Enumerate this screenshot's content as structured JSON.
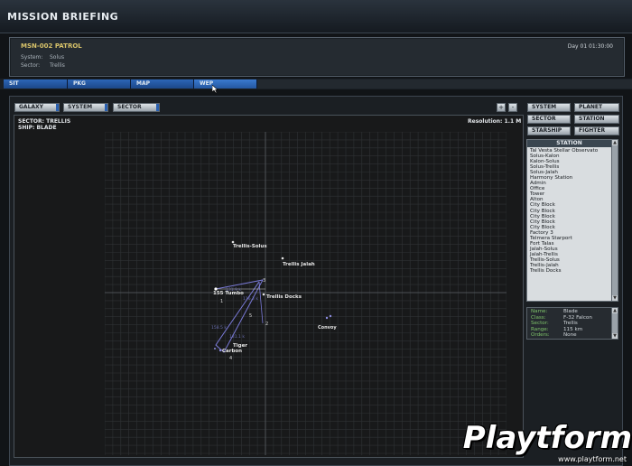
{
  "window": {
    "title": "MISSION BRIEFING"
  },
  "mission": {
    "name": "MSN-002 PATROL",
    "system_label": "System:",
    "system_value": "Solus",
    "sector_label": "Sector:",
    "sector_value": "Trellis",
    "day_time": "Day 01 01:30:00"
  },
  "tabs": [
    "SIT",
    "PKG",
    "MAP",
    "WEP"
  ],
  "scope": {
    "galaxy": "GALAXY",
    "system": "SYSTEM",
    "sector": "SECTOR"
  },
  "zoom": {
    "plus": "+",
    "minus": "-"
  },
  "map": {
    "sector_line": "SECTOR: TRELLIS",
    "ship_line": "SHIP: BLADE",
    "resolution": "Resolution: 1.1 M",
    "labels": {
      "trellis_solus": "Trellis-Solus",
      "trellis_jalah": "Trellis Jalah",
      "trellis_docks": "Trellis Docks",
      "tumbo": "155 Tumbo",
      "tiger": "Tiger",
      "carbon": "Carbon",
      "contacts": "Convoy"
    },
    "nav_points": [
      "1",
      "2",
      "3",
      "4",
      "5"
    ],
    "leg_labels": [
      "131.9 k",
      "116.3 k",
      "158.5 k",
      "131.1 k"
    ]
  },
  "filters": {
    "system": "SYSTEM",
    "planet": "PLANET",
    "sector": "SECTOR",
    "station": "STATION",
    "starship": "STARSHIP",
    "fighter": "FIGHTER"
  },
  "station_list": {
    "header": "STATION",
    "items": [
      "Tal Vesta Stellar Observato",
      "Solus-Kalon",
      "Kalon-Solus",
      "Solus-Trellis",
      "Solus-Jalah",
      "Harmony Station",
      "Admin",
      "Office",
      "Tower",
      "Alton",
      "City Block",
      "City Block",
      "City Block",
      "City Block",
      "City Block",
      "Factory 3",
      "Telmera Starport",
      "Fort Talas",
      "Jalah-Solus",
      "Jalah-Trellis",
      "Trellis-Solus",
      "Trellis-Jalah",
      "Trellis Docks"
    ]
  },
  "ship_info": {
    "name_label": "Name:",
    "name": "Blade",
    "class_label": "Class:",
    "class": "F-32 Falcon",
    "sector_label": "Sector:",
    "sector": "Trellis",
    "range_label": "Range:",
    "range": "115 km",
    "orders_label": "Orders:",
    "orders": "None"
  },
  "watermark": {
    "brand": "Playtform",
    "url": "www.playtform.net"
  },
  "colors": {
    "tab_blue": "#2c66b8",
    "accent_green": "#7fc46a",
    "route": "#7a7ad8",
    "title_gold": "#d8c36a"
  }
}
